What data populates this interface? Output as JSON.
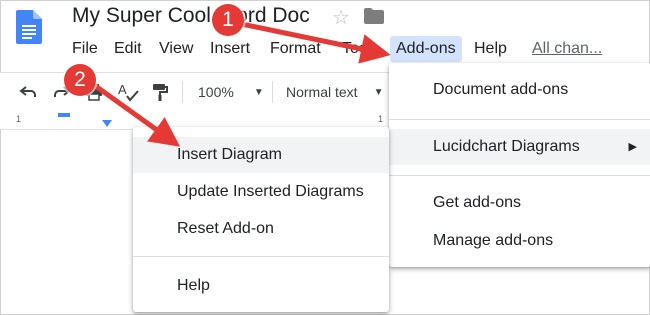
{
  "header": {
    "title": "My Super Cool Word Doc",
    "icons": {
      "doc": "google-docs-icon",
      "star": "star-icon",
      "folder": "folder-icon"
    },
    "star_glyph": "☆"
  },
  "menubar": {
    "file": "File",
    "edit": "Edit",
    "view": "View",
    "insert": "Insert",
    "format": "Format",
    "tools": "Too",
    "addons": "Add-ons",
    "help": "Help",
    "all_changes": "All chan..."
  },
  "toolbar": {
    "zoom": "100%",
    "style": "Normal text",
    "icons": [
      "undo-icon",
      "redo-icon",
      "print-icon",
      "spellcheck-icon",
      "paint-format-icon"
    ]
  },
  "ruler": {
    "numbers": [
      "1",
      "1"
    ]
  },
  "addons_menu": {
    "document_addons": "Document add-ons",
    "lucidchart": "Lucidchart Diagrams",
    "lucidchart_arrow": "▶",
    "get_addons": "Get add-ons",
    "manage_addons": "Manage add-ons"
  },
  "lucid_submenu": {
    "insert_diagram": "Insert Diagram",
    "update_inserted": "Update Inserted Diagrams",
    "reset_addon": "Reset Add-on",
    "help": "Help"
  },
  "annotations": {
    "badge1": "1",
    "badge2": "2",
    "color": "#e53935"
  },
  "colors": {
    "accent_blue": "#4285f4",
    "active_menu_bg": "#d3e3fd",
    "highlight_row": "#f1f3f4"
  }
}
